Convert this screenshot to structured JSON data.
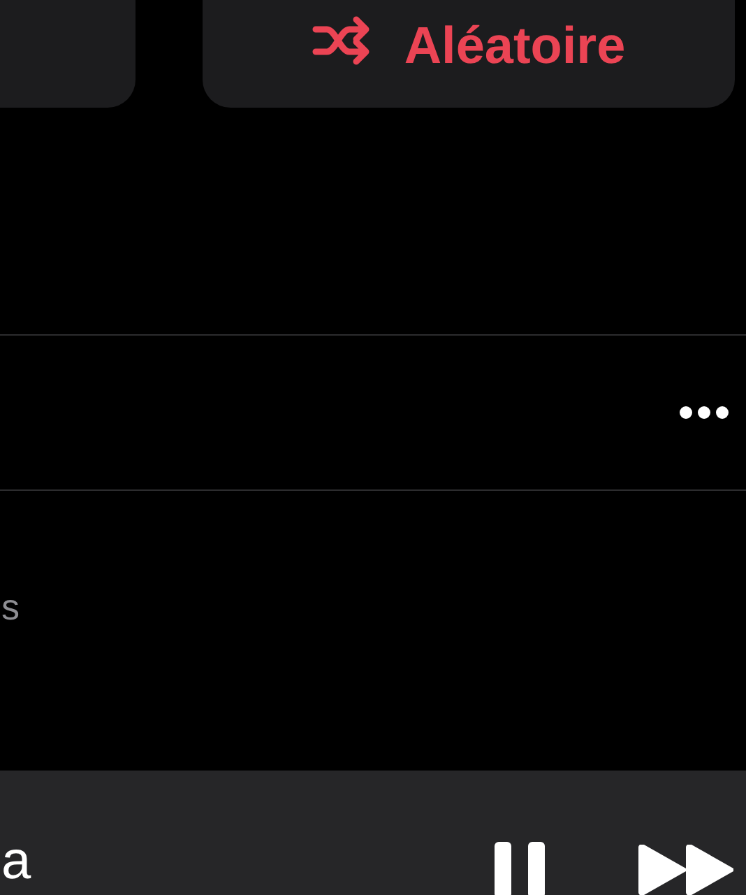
{
  "shuffle_button": {
    "label": "Aléatoire"
  },
  "list_row_text": "s",
  "mini_player": {
    "title": "a",
    "playing": true
  }
}
